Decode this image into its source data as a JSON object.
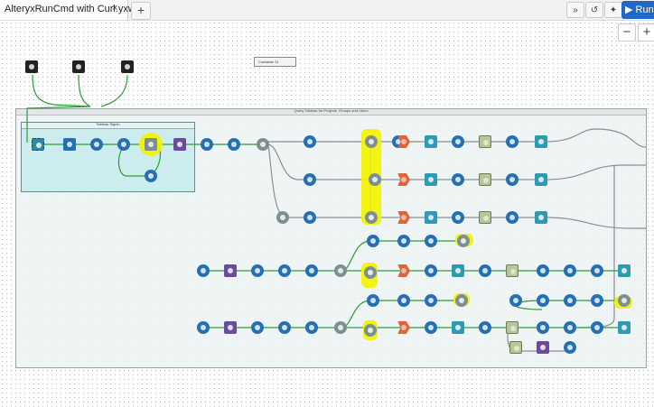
{
  "tab": {
    "title": "AlteryxRunCmd with Curl.yxwz*",
    "close_glyph": "×"
  },
  "new_tab_glyph": "+",
  "toolbar": {
    "expand_glyph": "»",
    "history_glyph": "↺",
    "magic_glyph": "✦",
    "run_label": "Run",
    "run_icon": "play-icon"
  },
  "zoom": {
    "out_glyph": "−",
    "in_glyph": "+"
  },
  "comment_box": {
    "text": "Container 11"
  },
  "main_container": {
    "title": "Query Tableau for Projects, Groups and Users"
  },
  "sub_container": {
    "title": "Tableau Signin"
  },
  "colors": {
    "accent": "#1f67c9",
    "wire_green": "#2e9b3a",
    "wire_grey": "#8a8f92",
    "highlight": "#f3f200"
  }
}
